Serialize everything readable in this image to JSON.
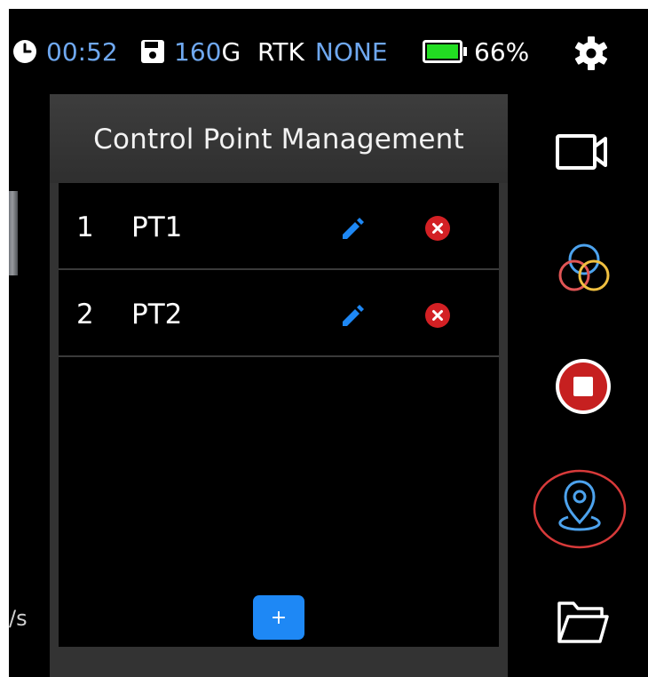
{
  "status": {
    "time": "00:52",
    "storage_value": "160",
    "storage_unit": "G",
    "rtk_label": "RTK",
    "rtk_value": "NONE",
    "battery": "66%",
    "battery_level": 0.66
  },
  "panel": {
    "title": "Control Point Management",
    "points": [
      {
        "index": "1",
        "name": "PT1"
      },
      {
        "index": "2",
        "name": "PT2"
      }
    ],
    "add_label": "+"
  },
  "left_edge_text": "/s",
  "colors": {
    "accent": "#1e88f5",
    "status_blue": "#6fa8f0",
    "delete_red": "#d32024",
    "battery_green": "#22dd22",
    "record_red": "#c62020"
  },
  "toolbar_icons": [
    "video-camera-icon",
    "color-circles-icon",
    "stop-record-icon",
    "location-pin-icon",
    "folder-icon"
  ]
}
